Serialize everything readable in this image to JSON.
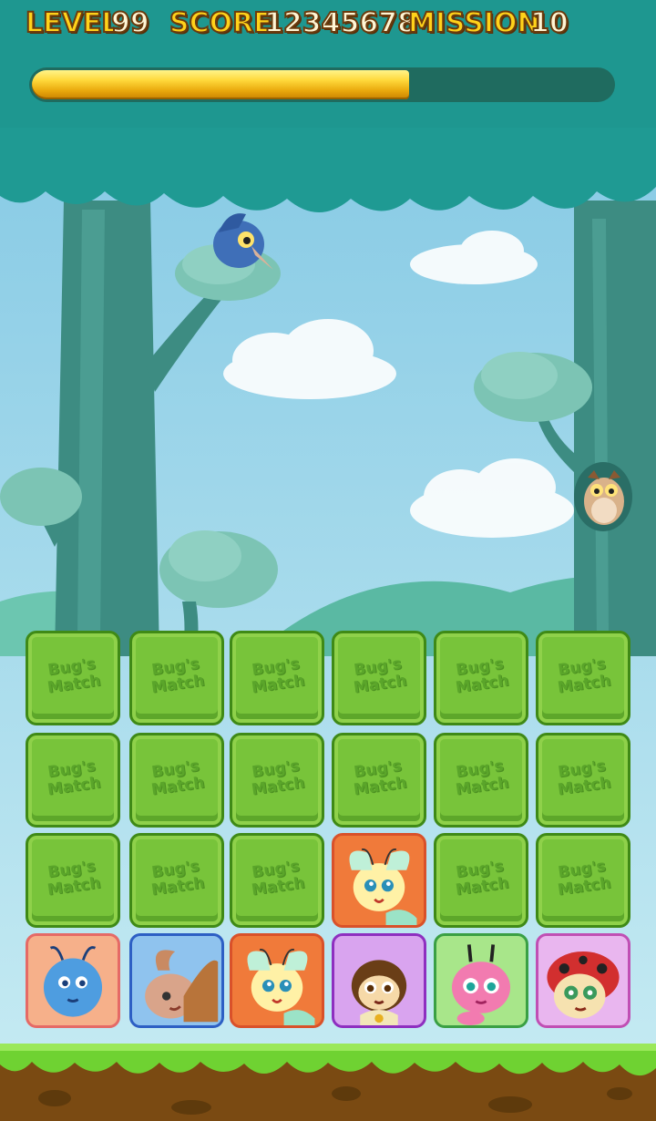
{
  "hud": {
    "level_label": "LEVEL",
    "level_value": "99",
    "score_label": "SCORE",
    "score_value": "12345678",
    "mission_label": "MISSION",
    "mission_value": "10",
    "progress": 0.65
  },
  "tile_logo_text": "Bug's Match",
  "tiles": [
    {
      "state": "hidden"
    },
    {
      "state": "hidden"
    },
    {
      "state": "hidden"
    },
    {
      "state": "hidden"
    },
    {
      "state": "hidden"
    },
    {
      "state": "hidden"
    },
    {
      "state": "hidden"
    },
    {
      "state": "hidden"
    },
    {
      "state": "hidden"
    },
    {
      "state": "hidden"
    },
    {
      "state": "hidden"
    },
    {
      "state": "hidden"
    },
    {
      "state": "hidden"
    },
    {
      "state": "hidden"
    },
    {
      "state": "hidden"
    },
    {
      "state": "revealed",
      "bug": "butterfly",
      "bg": "#f07a3a",
      "border": "#d9512a"
    },
    {
      "state": "hidden"
    },
    {
      "state": "hidden"
    },
    {
      "state": "revealed",
      "bug": "blue-ant",
      "bg": "#f6b08a",
      "border": "#e56a66"
    },
    {
      "state": "revealed",
      "bug": "beetle",
      "bg": "#8fc3ee",
      "border": "#2d5fc4"
    },
    {
      "state": "revealed",
      "bug": "butterfly",
      "bg": "#f07a3a",
      "border": "#d9512a"
    },
    {
      "state": "revealed",
      "bug": "bee",
      "bg": "#d9a4ef",
      "border": "#8e2fc0"
    },
    {
      "state": "revealed",
      "bug": "pink-caterpillar",
      "bg": "#a8e68a",
      "border": "#3aa044"
    },
    {
      "state": "revealed",
      "bug": "ladybug",
      "bg": "#e9b6ef",
      "border": "#c04fb4"
    }
  ],
  "colors": {
    "sky": "#8fd0e6",
    "canopy": "#1f9a93",
    "tree_trunk": "#3f8f85",
    "grass": "#6fd232",
    "soil": "#7a4a12",
    "hud_text": "#ffd21a"
  },
  "scene_elements": [
    "blue-bird-icon",
    "owl-icon",
    "cloud-icon",
    "tree-icon",
    "hill-icon"
  ]
}
